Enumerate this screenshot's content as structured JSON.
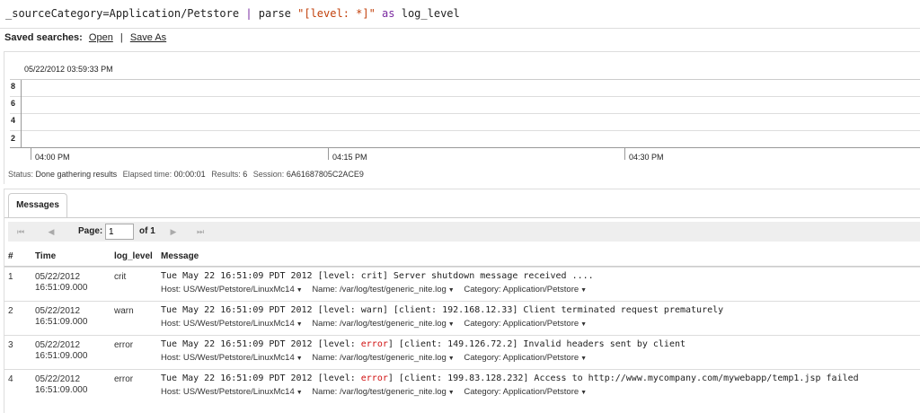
{
  "query": {
    "prefix": "_sourceCategory=Application/Petstore ",
    "pipe": "|",
    "op": " parse ",
    "string": "\"[level: *]\"",
    "as_kw": " as ",
    "field": "log_level"
  },
  "saved_searches": {
    "label": "Saved searches:",
    "open": "Open",
    "separator": "|",
    "save_as": "Save As"
  },
  "histogram": {
    "timestamp": "05/22/2012 03:59:33 PM",
    "y_ticks": [
      "8",
      "6",
      "4",
      "2"
    ],
    "x_ticks": [
      "04:00 PM",
      "04:15 PM",
      "04:30 PM"
    ]
  },
  "status": {
    "status_label": "Status:",
    "status_value": "Done gathering results",
    "elapsed_label": "Elapsed time:",
    "elapsed_value": "00:00:01",
    "results_label": "Results:",
    "results_value": "6",
    "session_label": "Session:",
    "session_value": "6A61687805C2ACE9"
  },
  "messages_tab": {
    "label": "Messages"
  },
  "pager": {
    "first": "⏮",
    "prev": "◀",
    "page_label": "Page:",
    "page_value": "1",
    "of_label": "of 1",
    "next": "▶",
    "last": "⏭"
  },
  "table": {
    "headers": {
      "num": "#",
      "time": "Time",
      "log_level": "log_level",
      "message": "Message"
    },
    "meta_labels": {
      "host": "Host:",
      "name": "Name:",
      "category": "Category:"
    },
    "rows": [
      {
        "num": "1",
        "date": "05/22/2012",
        "clock": "16:51:09.000",
        "level": "crit",
        "msg_pre": "Tue May 22 16:51:09 PDT 2012 [level: ",
        "msg_level": "crit",
        "msg_post": "] Server shutdown message received ....",
        "host": "US/West/Petstore/LinuxMc14",
        "name": "/var/log/test/generic_nite.log",
        "category": "Application/Petstore"
      },
      {
        "num": "2",
        "date": "05/22/2012",
        "clock": "16:51:09.000",
        "level": "warn",
        "msg_pre": "Tue May 22 16:51:09 PDT 2012 [level: ",
        "msg_level": "warn",
        "msg_post": "] [client: 192.168.12.33] Client terminated request prematurely",
        "host": "US/West/Petstore/LinuxMc14",
        "name": "/var/log/test/generic_nite.log",
        "category": "Application/Petstore"
      },
      {
        "num": "3",
        "date": "05/22/2012",
        "clock": "16:51:09.000",
        "level": "error",
        "msg_pre": "Tue May 22 16:51:09 PDT 2012 [level: ",
        "msg_level": "error",
        "msg_post": "] [client: 149.126.72.2]  Invalid headers sent by client",
        "host": "US/West/Petstore/LinuxMc14",
        "name": "/var/log/test/generic_nite.log",
        "category": "Application/Petstore"
      },
      {
        "num": "4",
        "date": "05/22/2012",
        "clock": "16:51:09.000",
        "level": "error",
        "msg_pre": "Tue May 22 16:51:09 PDT 2012 [level: ",
        "msg_level": "error",
        "msg_post": "] [client: 199.83.128.232] Access to http://www.mycompany.com/mywebapp/temp1.jsp failed",
        "host": "US/West/Petstore/LinuxMc14",
        "name": "/var/log/test/generic_nite.log",
        "category": "Application/Petstore"
      }
    ]
  },
  "colors": {
    "error_level": "#d01010",
    "query_keyword": "#7a2aa0",
    "query_string": "#c2410c"
  }
}
